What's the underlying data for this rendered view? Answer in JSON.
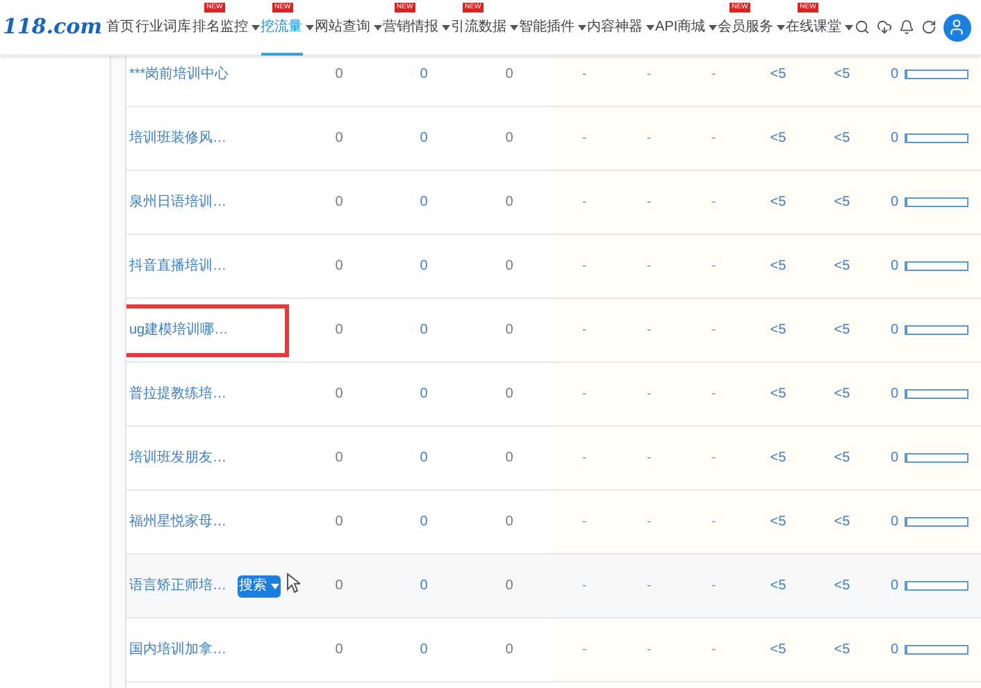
{
  "logo": "118.com",
  "nav": [
    {
      "label": "首页",
      "selected": false,
      "dropdown": false
    },
    {
      "label": "行业词库",
      "selected": false,
      "dropdown": false
    },
    {
      "label": "排名监控",
      "selected": false,
      "dropdown": true,
      "badge": "NEW"
    },
    {
      "label": "挖流量",
      "selected": true,
      "dropdown": true,
      "badge": "NEW"
    },
    {
      "label": "网站查询",
      "selected": false,
      "dropdown": true
    },
    {
      "label": "营销情报",
      "selected": false,
      "dropdown": true,
      "badge": "NEW"
    },
    {
      "label": "引流数据",
      "selected": false,
      "dropdown": true,
      "badge": "NEW"
    },
    {
      "label": "智能插件",
      "selected": false,
      "dropdown": true
    },
    {
      "label": "内容神器",
      "selected": false,
      "dropdown": true
    },
    {
      "label": "API商城",
      "selected": false,
      "dropdown": true
    },
    {
      "label": "会员服务",
      "selected": false,
      "dropdown": true,
      "badge": "NEW"
    },
    {
      "label": "在线课堂",
      "selected": false,
      "dropdown": true,
      "badge": "NEW"
    }
  ],
  "rows": [
    {
      "name": "***岗前培训中心",
      "cells": [
        "0",
        "0",
        "0",
        "-",
        "-",
        "-",
        "<5",
        "<5",
        "0"
      ],
      "level": 0,
      "hovered": false,
      "highlighted": false
    },
    {
      "name": "培训班装修风…",
      "cells": [
        "0",
        "0",
        "0",
        "-",
        "-",
        "-",
        "<5",
        "<5",
        "0"
      ],
      "level": 0,
      "hovered": false,
      "highlighted": false
    },
    {
      "name": "泉州日语培训…",
      "cells": [
        "0",
        "0",
        "0",
        "-",
        "-",
        "-",
        "<5",
        "<5",
        "0"
      ],
      "level": 0,
      "hovered": false,
      "highlighted": false
    },
    {
      "name": "抖音直播培训…",
      "cells": [
        "0",
        "0",
        "0",
        "-",
        "-",
        "-",
        "<5",
        "<5",
        "0"
      ],
      "level": 0,
      "hovered": false,
      "highlighted": false
    },
    {
      "name": "ug建模培训哪…",
      "cells": [
        "0",
        "0",
        "0",
        "-",
        "-",
        "-",
        "<5",
        "<5",
        "0"
      ],
      "level": 0,
      "hovered": false,
      "highlighted": true
    },
    {
      "name": "普拉提教练培…",
      "cells": [
        "0",
        "0",
        "0",
        "-",
        "-",
        "-",
        "<5",
        "<5",
        "0"
      ],
      "level": 0,
      "hovered": false,
      "highlighted": false
    },
    {
      "name": "培训班发朋友…",
      "cells": [
        "0",
        "0",
        "0",
        "-",
        "-",
        "-",
        "<5",
        "<5",
        "0"
      ],
      "level": 0,
      "hovered": false,
      "highlighted": false
    },
    {
      "name": "福州星悦家母…",
      "cells": [
        "0",
        "0",
        "0",
        "-",
        "-",
        "-",
        "<5",
        "<5",
        "0"
      ],
      "level": 0,
      "hovered": false,
      "highlighted": false
    },
    {
      "name": "语言矫正师培…",
      "cells": [
        "0",
        "0",
        "0",
        "-",
        "-",
        "-",
        "<5",
        "<5",
        "0"
      ],
      "level": 0,
      "hovered": true,
      "highlighted": false,
      "action_button": "搜索"
    },
    {
      "name": "国内培训加拿…",
      "cells": [
        "0",
        "0",
        "0",
        "-",
        "-",
        "-",
        "<5",
        "<5",
        "0"
      ],
      "level": 0,
      "hovered": false,
      "highlighted": false
    }
  ]
}
